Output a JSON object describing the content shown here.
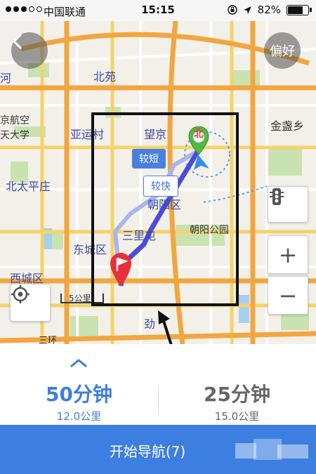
{
  "status_bar": {
    "carrier": "中国联通",
    "time": "15:15",
    "battery": "82%",
    "battery_level": 0.82
  },
  "map": {
    "labels": {
      "beiyuan": "北苑",
      "wangjing": "望京",
      "yayuncun": "亚运村",
      "jinzhanxiang": "金盏乡",
      "hangkong": "京航空",
      "tianda": "天大学",
      "beitaipingzhuang": "北太平庄",
      "chaoyangqu": "朝阳区",
      "sanlitun": "三里屯",
      "chaoyanggongyuan": "朝阳公园",
      "dongchengqu": "东城区",
      "xichengqu": "西城区",
      "dong": "东",
      "he": "河",
      "jin": "劲",
      "sanhuan": "三环"
    },
    "scale_label": "5公里",
    "compass_label": "北",
    "route_tags": {
      "shorter": "较短",
      "faster": "较快"
    }
  },
  "controls": {
    "back_icon": "chevron-left-icon",
    "preferences_label": "偏好",
    "traffic_icon": "traffic-light-icon",
    "zoom_in_label": "+",
    "zoom_out_label": "−",
    "locate_icon": "locate-icon"
  },
  "routes": [
    {
      "duration": "50分钟",
      "distance": "12.0公里",
      "color": "#3d7fe0"
    },
    {
      "duration": "25分钟",
      "distance": "15.0公里",
      "color": "#666666"
    }
  ],
  "navigation": {
    "start_label": "开始导航(7)"
  }
}
